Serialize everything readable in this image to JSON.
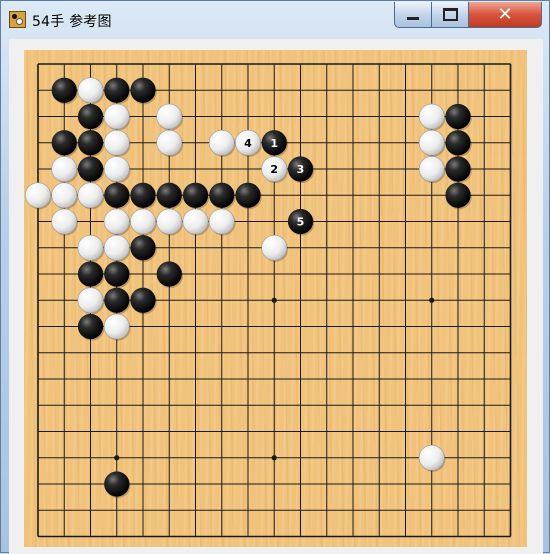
{
  "window": {
    "title": "54手 参考图",
    "minimize_icon": "minimize-icon",
    "maximize_icon": "maximize-icon",
    "close_icon": "close-icon",
    "close_glyph": "✕"
  },
  "board": {
    "size": 19,
    "colors": {
      "board": "#f1c27a",
      "line": "#1a1a1a"
    },
    "star_points": [
      [
        3,
        3
      ],
      [
        9,
        3
      ],
      [
        15,
        3
      ],
      [
        3,
        9
      ],
      [
        9,
        9
      ],
      [
        15,
        9
      ],
      [
        3,
        15
      ],
      [
        9,
        15
      ],
      [
        15,
        15
      ]
    ],
    "black_stones": [
      [
        1,
        1
      ],
      [
        3,
        1
      ],
      [
        4,
        1
      ],
      [
        2,
        2
      ],
      [
        1,
        3
      ],
      [
        2,
        3
      ],
      [
        2,
        4
      ],
      [
        3,
        5
      ],
      [
        4,
        5
      ],
      [
        5,
        5
      ],
      [
        6,
        5
      ],
      [
        7,
        5
      ],
      [
        8,
        5
      ],
      [
        4,
        7
      ],
      [
        2,
        8
      ],
      [
        3,
        8
      ],
      [
        5,
        8
      ],
      [
        3,
        9
      ],
      [
        4,
        9
      ],
      [
        2,
        10
      ],
      [
        16,
        2
      ],
      [
        16,
        3
      ],
      [
        16,
        4
      ],
      [
        16,
        5
      ],
      [
        3,
        16
      ]
    ],
    "white_stones": [
      [
        2,
        1
      ],
      [
        3,
        2
      ],
      [
        5,
        2
      ],
      [
        3,
        3
      ],
      [
        5,
        3
      ],
      [
        7,
        3
      ],
      [
        1,
        4
      ],
      [
        3,
        4
      ],
      [
        0,
        5
      ],
      [
        1,
        5
      ],
      [
        2,
        5
      ],
      [
        1,
        6
      ],
      [
        3,
        6
      ],
      [
        4,
        6
      ],
      [
        5,
        6
      ],
      [
        6,
        6
      ],
      [
        7,
        6
      ],
      [
        2,
        7
      ],
      [
        3,
        7
      ],
      [
        9,
        7
      ],
      [
        2,
        9
      ],
      [
        3,
        10
      ],
      [
        15,
        2
      ],
      [
        15,
        3
      ],
      [
        15,
        4
      ],
      [
        15,
        15
      ]
    ],
    "numbered_moves": [
      {
        "number": "1",
        "color": "black",
        "point": [
          9,
          3
        ]
      },
      {
        "number": "2",
        "color": "white",
        "point": [
          9,
          4
        ]
      },
      {
        "number": "3",
        "color": "black",
        "point": [
          10,
          4
        ]
      },
      {
        "number": "4",
        "color": "white",
        "point": [
          8,
          3
        ]
      },
      {
        "number": "5",
        "color": "black",
        "point": [
          10,
          6
        ]
      }
    ]
  }
}
